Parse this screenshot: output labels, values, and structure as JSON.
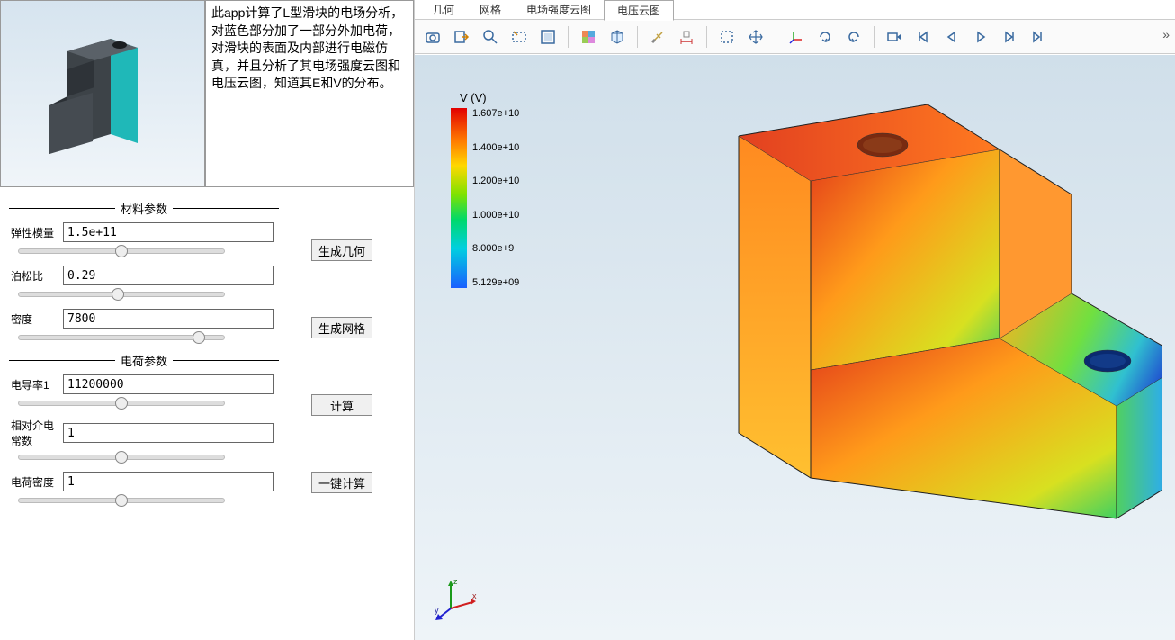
{
  "description": "此app计算了L型滑块的电场分析，对蓝色部分加了一部分外加电荷，对滑块的表面及内部进行电磁仿真，并且分析了其电场强度云图和电压云图，知道其E和V的分布。",
  "sections": {
    "material_title": "材料参数",
    "charge_title": "电荷参数"
  },
  "params": {
    "elastic_modulus": {
      "label": "弹性模量",
      "value": "1.5e+11"
    },
    "poisson_ratio": {
      "label": "泊松比",
      "value": "0.29"
    },
    "density": {
      "label": "密度",
      "value": "7800"
    },
    "conductivity1": {
      "label": "电导率1",
      "value": "11200000"
    },
    "rel_permittivity": {
      "label": "相对介电常数",
      "value": "1"
    },
    "charge_density": {
      "label": "电荷密度",
      "value": "1"
    }
  },
  "buttons": {
    "gen_geom": "生成几何",
    "gen_mesh": "生成网格",
    "compute": "计算",
    "one_click": "一键计算"
  },
  "tabs": {
    "geom": "几何",
    "mesh": "网格",
    "e_cloud": "电场强度云图",
    "v_cloud": "电压云图"
  },
  "colorbar": {
    "title": "V (V)",
    "labels": [
      "1.607e+10",
      "1.400e+10",
      "1.200e+10",
      "1.000e+10",
      "8.000e+9",
      "5.129e+09"
    ]
  },
  "more_glyph": "»"
}
